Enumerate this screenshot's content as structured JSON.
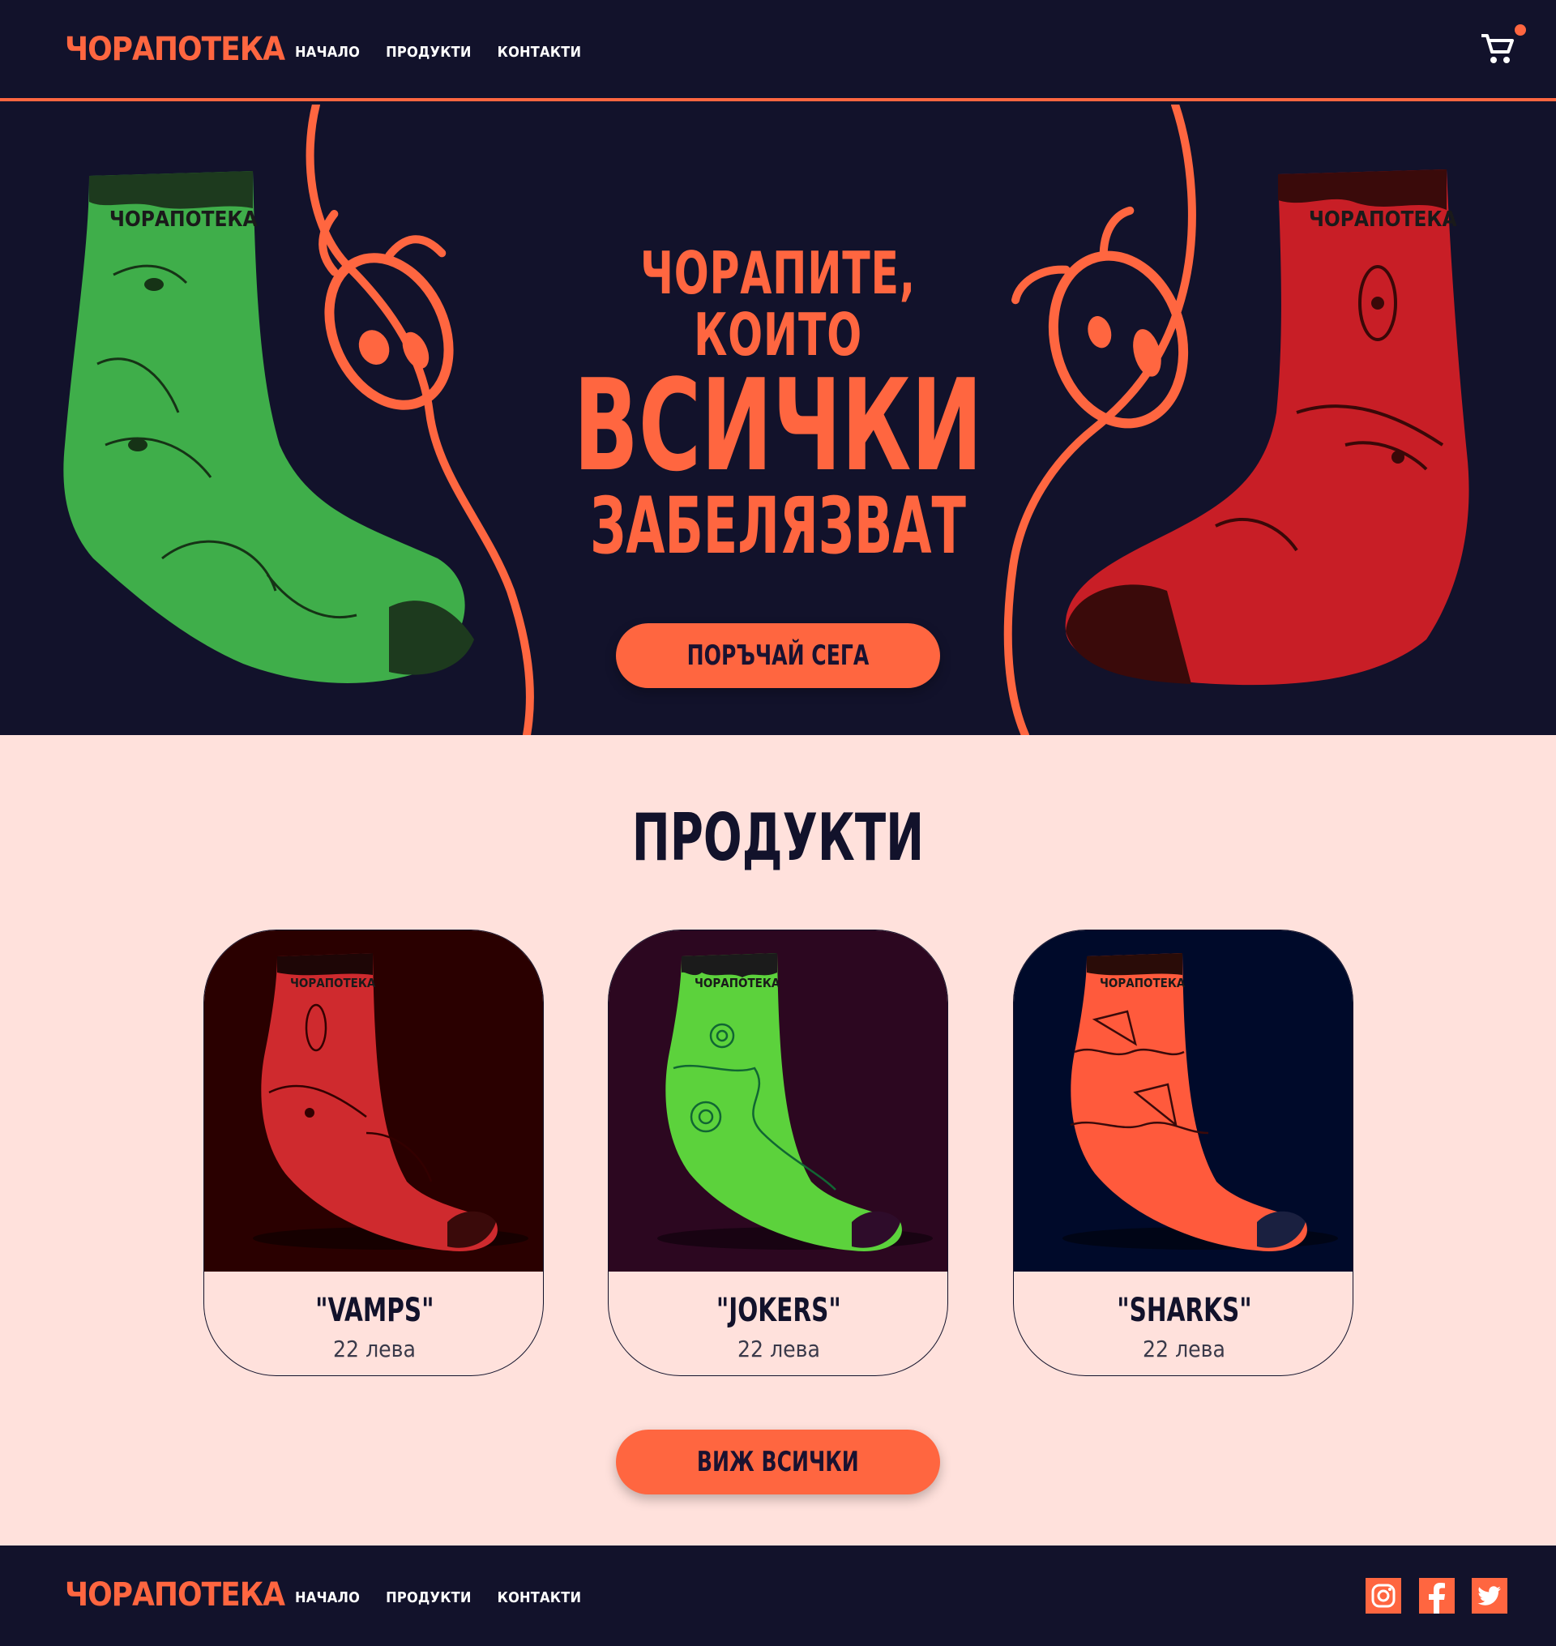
{
  "brand": {
    "name": "ЧОРАПОТЕКА",
    "accent": "#ff6640",
    "dark": "#12122b",
    "light": "#ffe1dc"
  },
  "header": {
    "nav": [
      "НАЧАЛО",
      "ПРОДУКТИ",
      "КОНТАКТИ"
    ],
    "cart_icon": "shopping-cart-icon"
  },
  "hero": {
    "line1": "ЧОРАПИТЕ, КОИТО",
    "line2": "ВСИЧКИ",
    "line3": "ЗАБЕЛЯЗВАТ",
    "cta": "ПОРЪЧАЙ СЕГА",
    "sock_left_label": "ЧОРАПОТЕКА",
    "sock_right_label": "ЧОРАПОТЕКА"
  },
  "products": {
    "title": "ПРОДУКТИ",
    "items": [
      {
        "name": "\"VAMPS\"",
        "price": "22 лева",
        "bg": "#2a0000",
        "sock": "#d8242a",
        "label": "ЧОРАПОТЕКА"
      },
      {
        "name": "\"JOKERS\"",
        "price": "22 лева",
        "bg": "#2c0720",
        "sock": "#59d23a",
        "label": "ЧОРАПОТЕКА"
      },
      {
        "name": "\"SHARKS\"",
        "price": "22 лева",
        "bg": "#000a2a",
        "sock": "#ff5a3c",
        "label": "ЧОРАПОТЕКА"
      }
    ],
    "see_all": "ВИЖ ВСИЧКИ"
  },
  "footer": {
    "nav": [
      "НАЧАЛО",
      "ПРОДУКТИ",
      "КОНТАКТИ"
    ],
    "social": [
      "instagram-icon",
      "facebook-icon",
      "twitter-icon"
    ]
  }
}
